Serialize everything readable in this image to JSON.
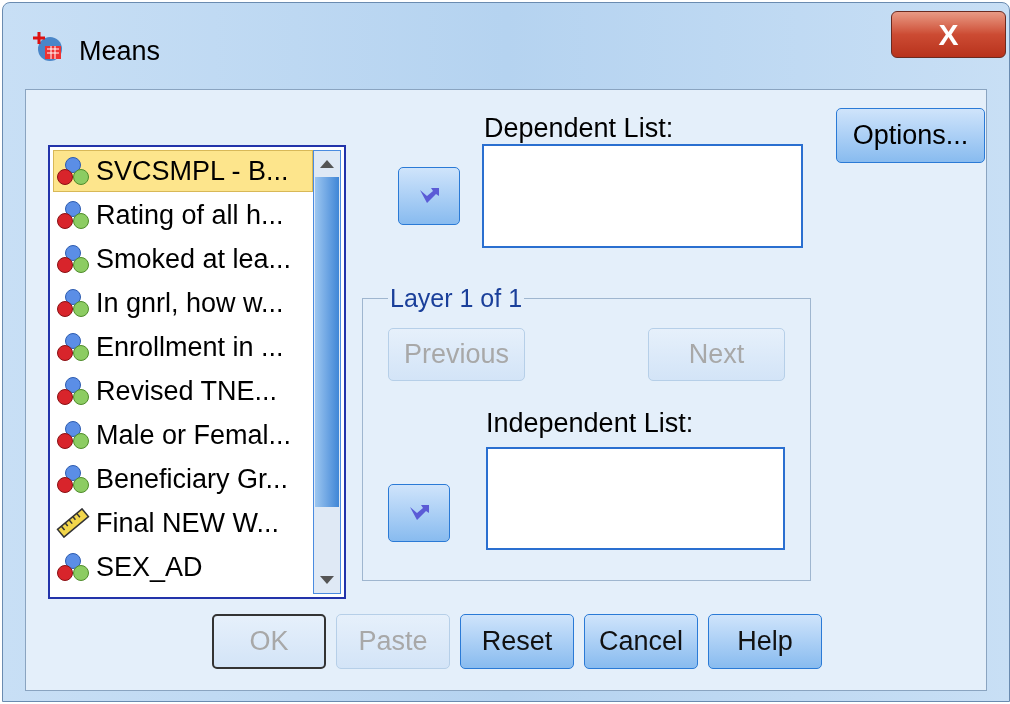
{
  "window": {
    "title": "Means",
    "close_label": "X"
  },
  "variables": [
    {
      "name": "SVCSMPL - B...",
      "kind": "nominal",
      "selected": true
    },
    {
      "name": "Rating of all h...",
      "kind": "nominal",
      "selected": false
    },
    {
      "name": "Smoked at lea...",
      "kind": "nominal",
      "selected": false
    },
    {
      "name": "In gnrl, how w...",
      "kind": "nominal",
      "selected": false
    },
    {
      "name": "Enrollment in ...",
      "kind": "nominal",
      "selected": false
    },
    {
      "name": "Revised TNE...",
      "kind": "nominal",
      "selected": false
    },
    {
      "name": "Male or Femal...",
      "kind": "nominal",
      "selected": false
    },
    {
      "name": "Beneficiary Gr...",
      "kind": "nominal",
      "selected": false
    },
    {
      "name": "Final NEW W...",
      "kind": "scale",
      "selected": false
    },
    {
      "name": "SEX_AD",
      "kind": "nominal",
      "selected": false
    }
  ],
  "dependent_list": {
    "label": "Dependent List:"
  },
  "options_button": "Options...",
  "layer": {
    "title": "Layer 1 of 1",
    "previous": {
      "label": "Previous",
      "disabled": true
    },
    "next": {
      "label": "Next",
      "disabled": true
    },
    "independent_list": {
      "label": "Independent List:"
    }
  },
  "buttons": [
    {
      "label": "OK",
      "disabled": true,
      "default": true
    },
    {
      "label": "Paste",
      "disabled": true,
      "default": false
    },
    {
      "label": "Reset",
      "disabled": false,
      "default": false
    },
    {
      "label": "Cancel",
      "disabled": false,
      "default": false
    },
    {
      "label": "Help",
      "disabled": false,
      "default": false
    }
  ]
}
